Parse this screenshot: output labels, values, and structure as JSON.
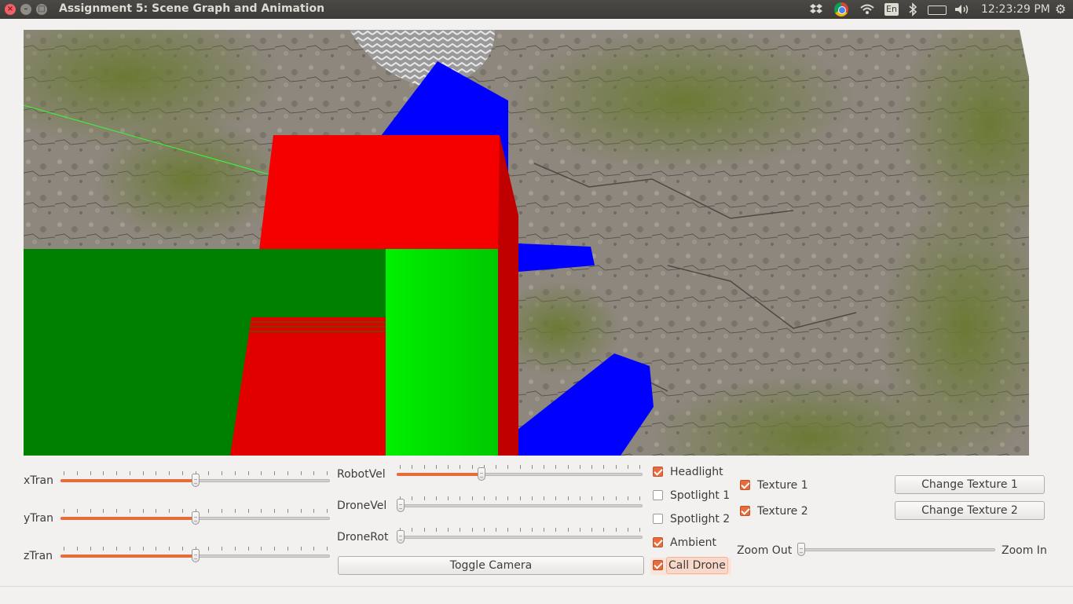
{
  "window": {
    "title": "Assignment 5: Scene Graph and Animation",
    "close_glyph": "×",
    "minimize_glyph": "–",
    "maximize_glyph": "□"
  },
  "tray": {
    "language": "En",
    "clock": "12:23:29 PM",
    "icons": [
      "dropbox-icon",
      "chrome-icon",
      "wifi-icon",
      "keyboard-language-icon",
      "bluetooth-icon",
      "battery-icon",
      "volume-icon",
      "settings-gear-icon"
    ]
  },
  "transform_sliders": [
    {
      "label": "xTran",
      "value": 0.5
    },
    {
      "label": "yTran",
      "value": 0.5
    },
    {
      "label": "zTran",
      "value": 0.5
    }
  ],
  "velocity_sliders": [
    {
      "label": "RobotVel",
      "value": 0.34
    },
    {
      "label": "DroneVel",
      "value": 0.0
    },
    {
      "label": "DroneRot",
      "value": 0.0
    }
  ],
  "toggle_camera": {
    "label": "Toggle Camera"
  },
  "lights": [
    {
      "label": "Headlight",
      "checked": true
    },
    {
      "label": "Spotlight 1",
      "checked": false
    },
    {
      "label": "Spotlight 2",
      "checked": false
    },
    {
      "label": "Ambient",
      "checked": true
    },
    {
      "label": "Call Drone",
      "checked": true
    }
  ],
  "textures": [
    {
      "label": "Texture 1",
      "checked": true
    },
    {
      "label": "Texture 2",
      "checked": true
    }
  ],
  "texture_buttons": [
    {
      "label": "Change Texture 1"
    },
    {
      "label": "Change Texture 2"
    }
  ],
  "zoom": {
    "min_label": "Zoom Out",
    "max_label": "Zoom In",
    "value": 0.0
  },
  "colors": {
    "accent": "#e86b3b",
    "robot_red": "#f20000",
    "robot_green": "#008000",
    "bright_green": "#00e600",
    "drone_blue": "#0000ff"
  }
}
